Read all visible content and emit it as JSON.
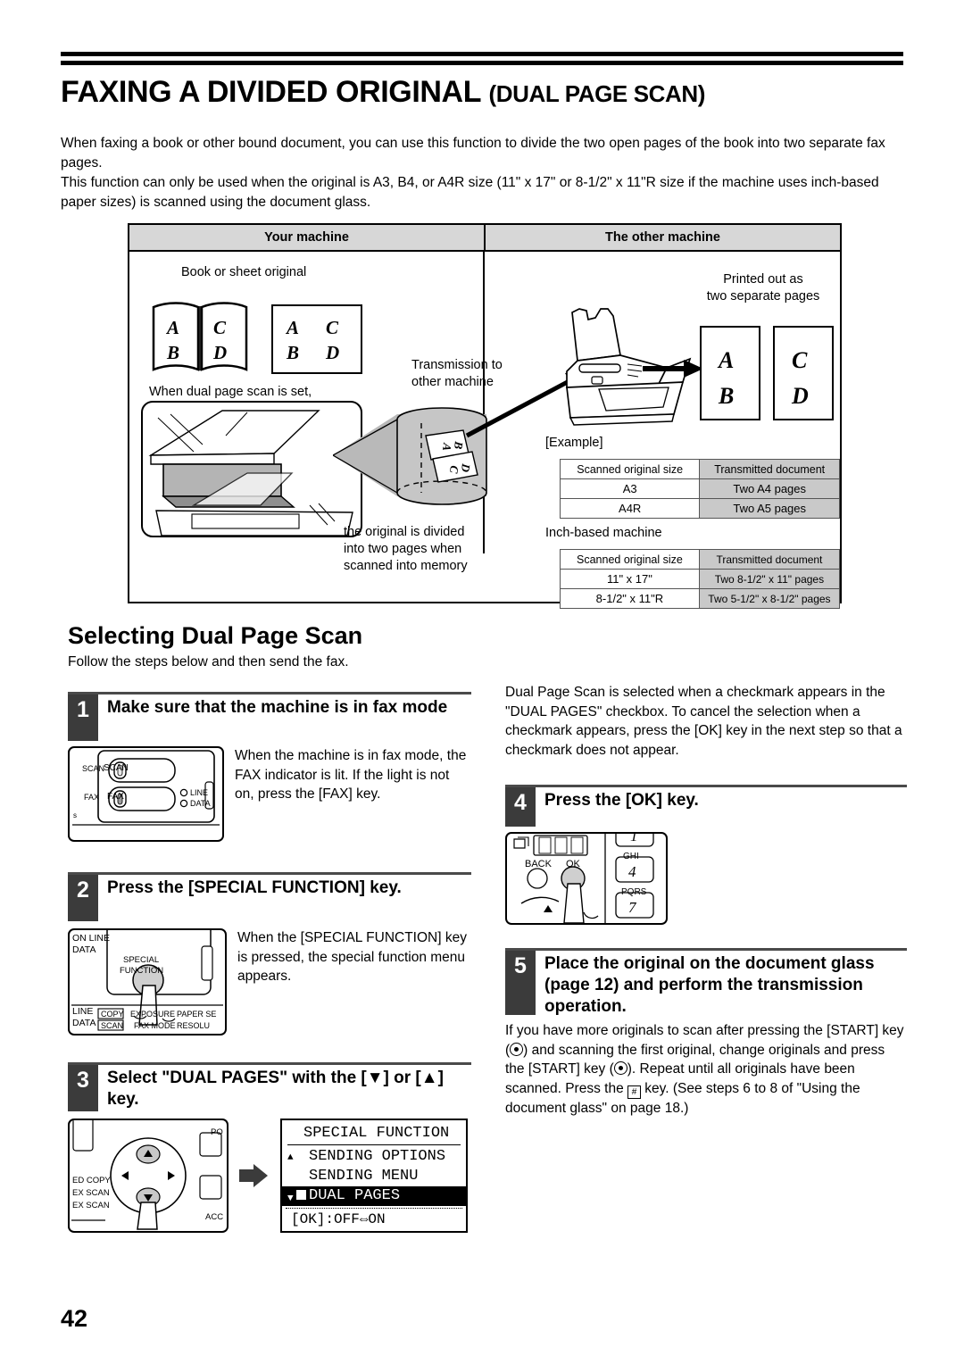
{
  "title": {
    "main": "FAXING A DIVIDED ORIGINAL ",
    "sub": "(DUAL PAGE SCAN)"
  },
  "intro": {
    "p1": "When faxing a book or other bound document, you can use this function to divide the two open pages of the book into two separate fax pages.",
    "p2": "This function can only be used when the original is A3, B4, or A4R size (11\" x 17\" or 8-1/2\" x 11\"R size if the machine uses inch-based paper sizes) is scanned using the document glass."
  },
  "figure": {
    "header_left": "Your machine",
    "header_right": "The other machine",
    "label_book": "Book or sheet original",
    "label_dualset": "When dual page scan is set,",
    "label_divided": "the original is divided\ninto two pages when\nscanned into memory",
    "label_transmission": "Transmission to\nother machine",
    "label_printed": "Printed out as\ntwo separate pages",
    "book_letters": [
      "A",
      "C",
      "B",
      "D"
    ],
    "sheet_letters": [
      "A",
      "C",
      "B",
      "D"
    ],
    "out_letters": [
      "A",
      "B",
      "C",
      "D"
    ],
    "example_label": "[Example]",
    "inch_label": "Inch-based machine",
    "table_metric": {
      "headers": [
        "Scanned original size",
        "Transmitted document"
      ],
      "rows": [
        [
          "A3",
          "Two A4 pages"
        ],
        [
          "A4R",
          "Two A5 pages"
        ]
      ]
    },
    "table_inch": {
      "headers": [
        "Scanned original size",
        "Transmitted document"
      ],
      "rows": [
        [
          "11\" x 17\"",
          "Two 8-1/2\" x 11\" pages"
        ],
        [
          "8-1/2\" x 11\"R",
          "Two 5-1/2\" x 8-1/2\" pages"
        ]
      ]
    }
  },
  "section": {
    "title": "Selecting Dual Page Scan",
    "subtitle": "Follow the steps below and then send the fax."
  },
  "steps": {
    "s1": {
      "num": "1",
      "title": "Make sure that the machine is in fax mode",
      "body": "When the machine is in fax mode, the FAX indicator is lit. If the light is not on, press the [FAX] key.",
      "panel": {
        "scan": "SCAN",
        "fax": "FAX",
        "line": "LINE",
        "data": "DATA"
      }
    },
    "s2": {
      "num": "2",
      "title": "Press the [SPECIAL FUNCTION] key.",
      "body": "When the [SPECIAL FUNCTION] key is pressed, the special function menu appears.",
      "panel": {
        "on_line": "ON LINE",
        "data_top": "DATA",
        "special": "SPECIAL",
        "function": "FUNCTION",
        "line": "LINE",
        "data_bottom": "DATA",
        "k1": "COPY",
        "k2": "EXPOSURE",
        "k3": "PAPER SE",
        "k4": "SCAN",
        "k5": "FAX MODE",
        "k6": "RESOLU"
      }
    },
    "s3": {
      "num": "3",
      "title": "Select \"DUAL PAGES\" with the [▼] or [▲] key.",
      "panel": {
        "l1": "ED COPY",
        "l2": "EX SCAN",
        "l3": "EX SCAN",
        "r1": "PO",
        "r2": "ACC"
      },
      "lcd": {
        "title": "SPECIAL FUNCTION",
        "item1": "SENDING OPTIONS",
        "item2": "SENDING MENU",
        "item3": "DUAL PAGES",
        "footer": "[OK]:OFF⇔ON"
      }
    },
    "s4": {
      "num": "4",
      "title": "Press the [OK] key.",
      "panel": {
        "display": "888",
        "back": "BACK",
        "ok": "OK",
        "key1": "1",
        "ghi": "GHI",
        "key4": "4",
        "pqrs": "PQRS",
        "key7": "7"
      }
    },
    "s5": {
      "num": "5",
      "title": "Place the original on the document glass (page 12) and perform the transmission operation.",
      "body_a": "If you have more originals to scan after pressing the [START] key (",
      "body_b": ") and scanning the first original, change originals and press the [START] key (",
      "body_c": "). Repeat until all originals have been scanned. Press the ",
      "body_d": " key. (See steps 6 to 8 of \"Using the document glass\" on page 18.)"
    }
  },
  "right_note": "Dual Page Scan is selected when a checkmark appears in the \"DUAL PAGES\" checkbox. To cancel the selection when a checkmark appears, press the [OK] key in the next step so that a checkmark does not appear.",
  "page_number": "42"
}
